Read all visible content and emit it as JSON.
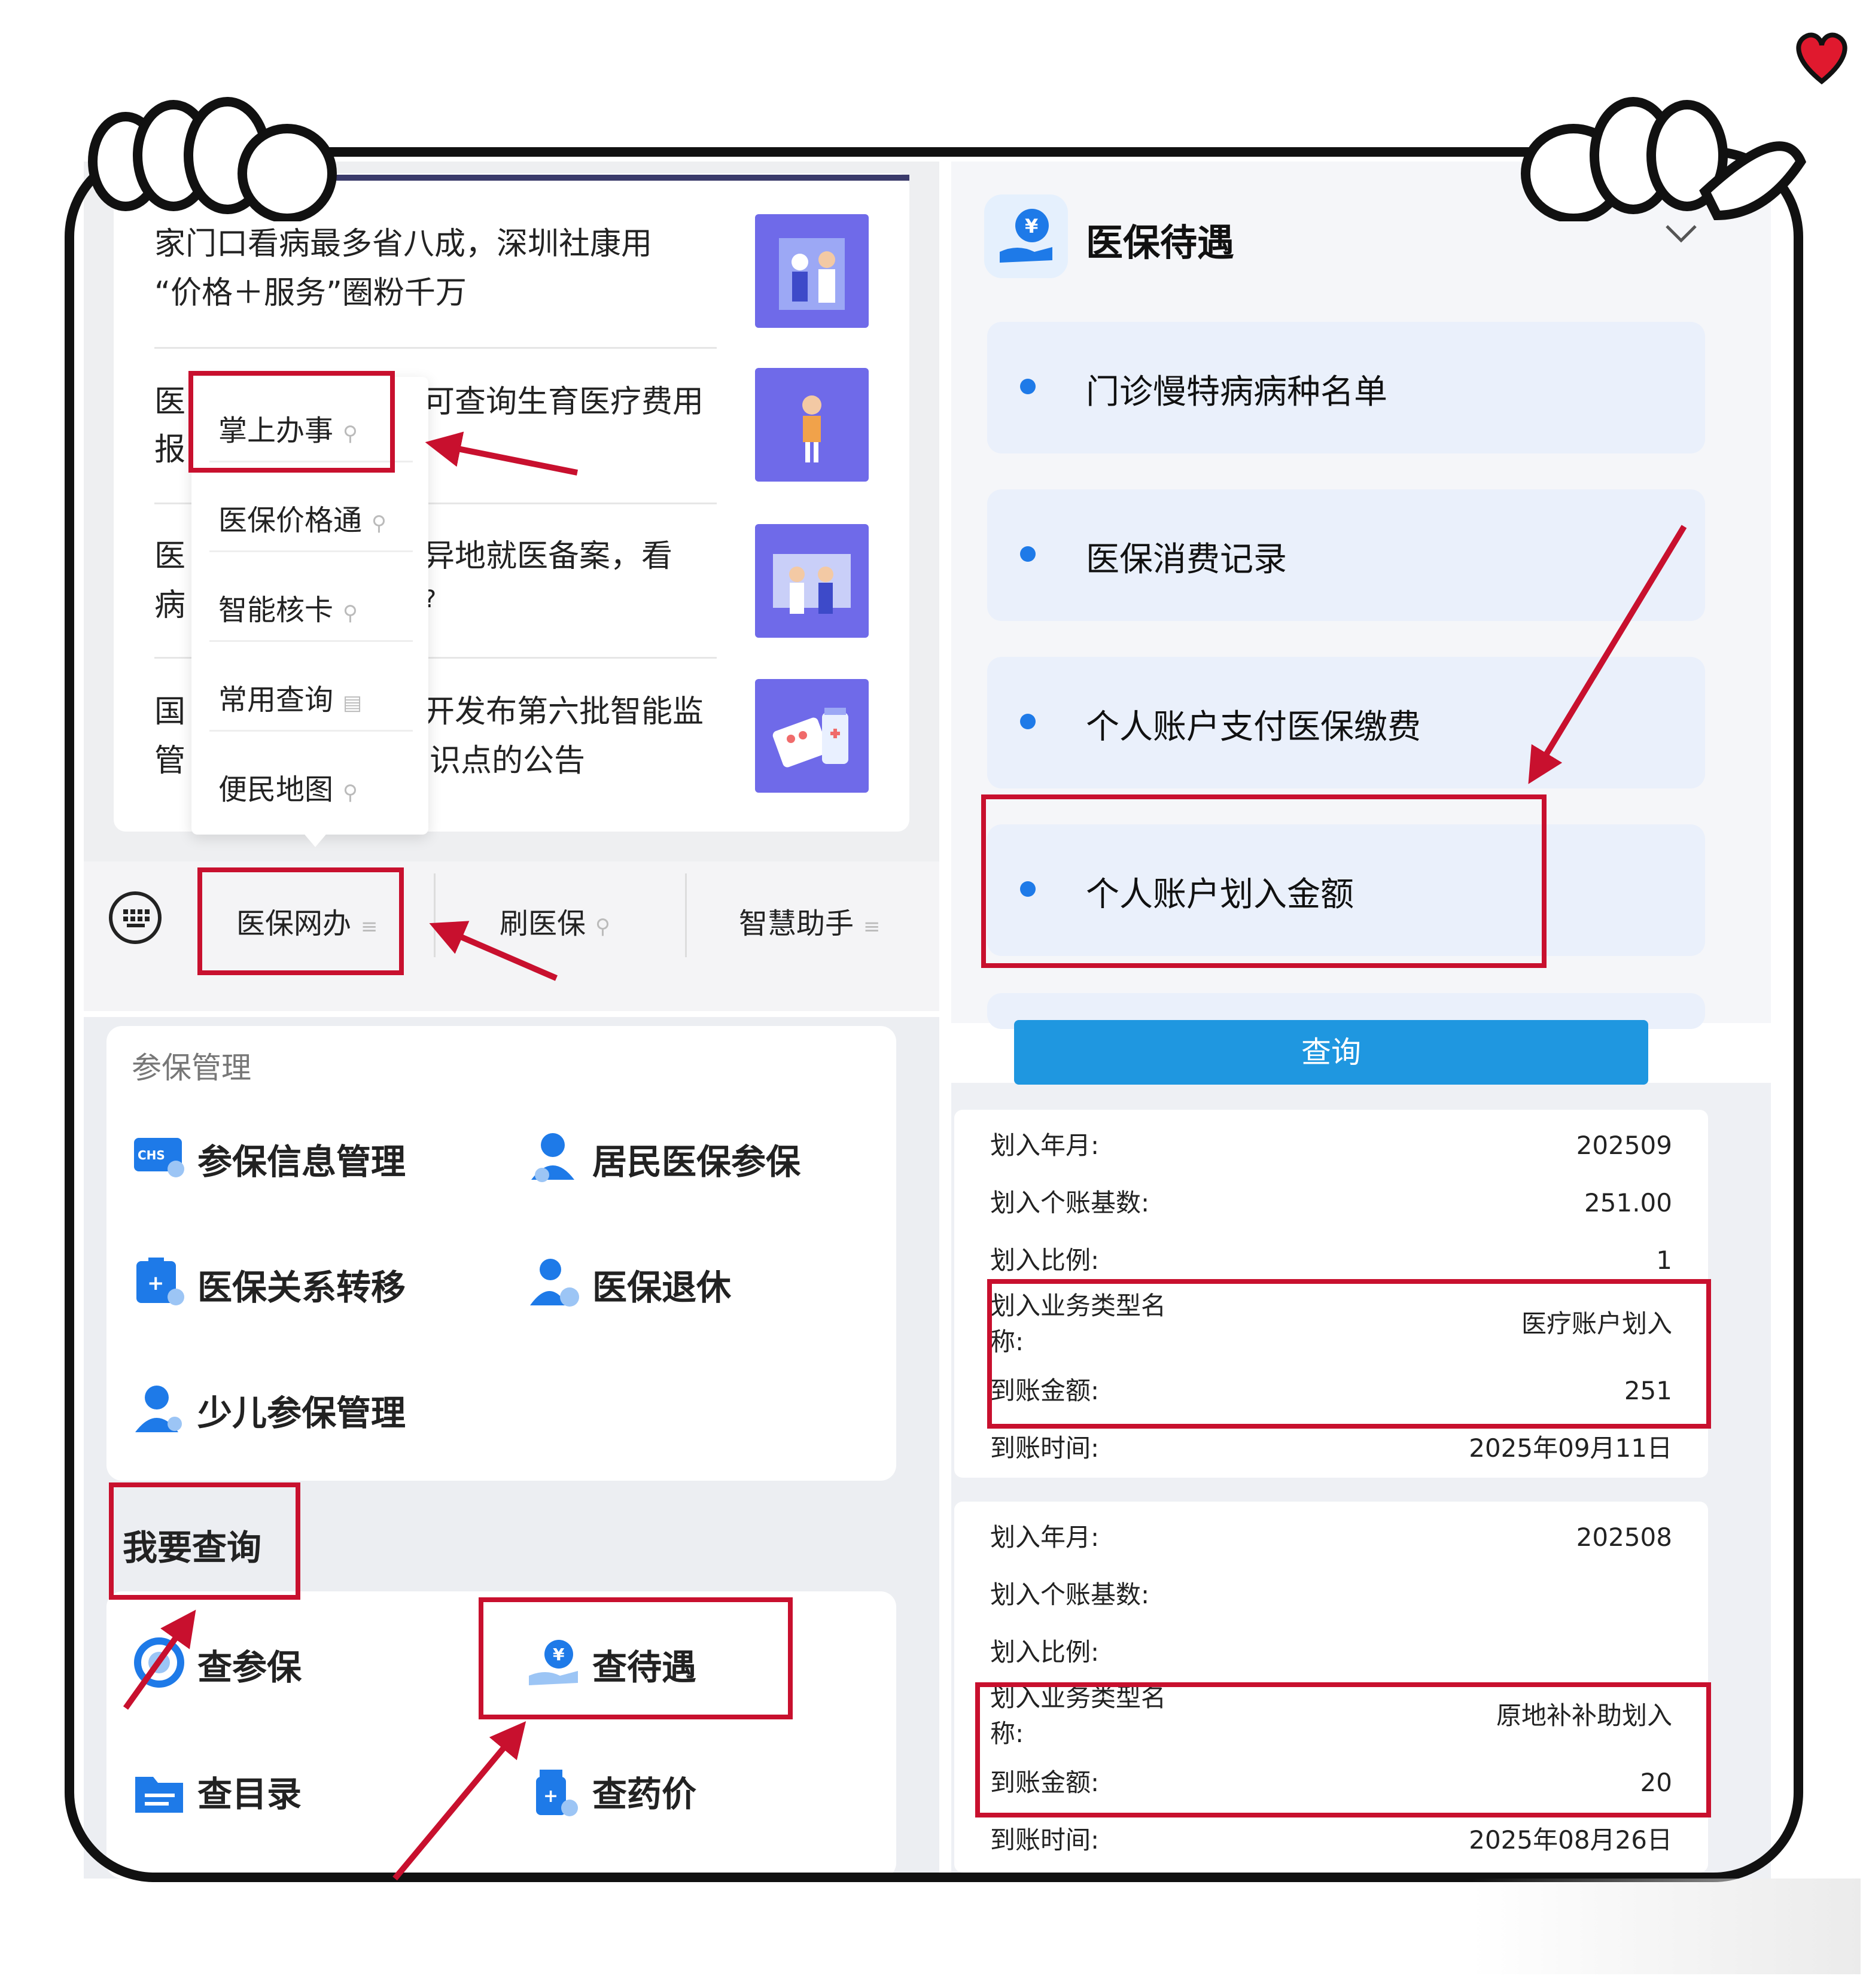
{
  "news": {
    "items": [
      {
        "line1": "家门口看病最多省八成，深圳社康用",
        "line2": "“价格＋服务”圈粉千万"
      },
      {
        "line1_left": "医",
        "line1_right": "可查询生育医疗费用",
        "line2_left": "报"
      },
      {
        "line1_left": "医",
        "line1_right": "异地就医备案，看",
        "line2_left": "病",
        "line2_right": "?"
      },
      {
        "line1_left": "国",
        "line1_right": "开发布第六批智能监",
        "line2_left": "管",
        "line2_right": "识点的公告"
      }
    ]
  },
  "dropdown": {
    "items": [
      "掌上办事",
      "医保价格通",
      "智能核卡",
      "常用查询",
      "便民地图"
    ]
  },
  "bottom_bar": {
    "items": [
      "医保网办",
      "刷医保",
      "智慧助手"
    ]
  },
  "services": {
    "section1_title": "参保管理",
    "section1_items": [
      "参保信息管理",
      "居民医保参保",
      "医保关系转移",
      "医保退休",
      "少儿参保管理"
    ],
    "section2_title": "我要查询",
    "section2_items": [
      "查参保",
      "查待遇",
      "查目录",
      "查药价"
    ]
  },
  "benefits": {
    "title": "医保待遇",
    "items": [
      "门诊慢特病病种名单",
      "医保消费记录",
      "个人账户支付医保缴费",
      "个人账户划入金额"
    ],
    "query_label": "查询"
  },
  "records": [
    {
      "month_label": "划入年月:",
      "month": "202509",
      "base_label": "划入个账基数:",
      "base": "251.00",
      "ratio_label": "划入比例:",
      "ratio": "1",
      "type_label_1": "划入业务类型名",
      "type_label_2": "称:",
      "type": "医疗账户划入",
      "amount_label": "到账金额:",
      "amount": "251",
      "time_label": "到账时间:",
      "time": "2025年09月11日"
    },
    {
      "month_label": "划入年月:",
      "month": "202508",
      "base_label": "划入个账基数:",
      "base": "",
      "ratio_label": "划入比例:",
      "ratio": "",
      "type_label_1": "划入业务类型名",
      "type_label_2": "称:",
      "type": "原地补补助划入",
      "amount_label": "到账金额:",
      "amount": "20",
      "time_label": "到账时间:",
      "time": "2025年08月26日"
    }
  ],
  "colors": {
    "accent": "#1f97e0",
    "annotation_red": "#c8102e",
    "thumb_purple": "#6f6ae9",
    "dot_blue": "#1e7ae8"
  }
}
